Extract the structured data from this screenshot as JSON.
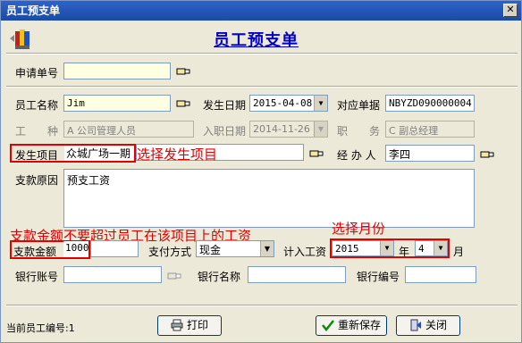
{
  "window": {
    "title": "员工预支单",
    "close_glyph": "✕"
  },
  "form_title": "员工预支单",
  "fields": {
    "request_no": {
      "label": "申请单号",
      "value": ""
    },
    "employee_name": {
      "label": "员工名称",
      "value": "Jim"
    },
    "occur_date": {
      "label": "发生日期",
      "value": "2015-04-08"
    },
    "ref_no": {
      "label": "对应单据",
      "value": "NBYZD090000004"
    },
    "job_type": {
      "label": "工　　种",
      "value": "A 公司管理人员"
    },
    "hire_date": {
      "label": "入职日期",
      "value": "2014-11-26"
    },
    "position": {
      "label": "职　　务",
      "value": "C 副总经理"
    },
    "project": {
      "label": "发生项目",
      "value": "众城广场一期"
    },
    "handler": {
      "label": "经 办 人",
      "value": "李四"
    },
    "reason": {
      "label": "支款原因",
      "value": "预支工资"
    },
    "amount": {
      "label": "支款金额",
      "value": "1000"
    },
    "pay_method": {
      "label": "支付方式",
      "value": "现金"
    },
    "salary_period": {
      "label": "计入工资",
      "year": "2015",
      "year_unit": "年",
      "month": "4",
      "month_unit": "月"
    },
    "bank_account": {
      "label": "银行账号",
      "value": ""
    },
    "bank_name": {
      "label": "银行名称",
      "value": ""
    },
    "bank_code": {
      "label": "银行编号",
      "value": ""
    }
  },
  "annotations": {
    "project": "选择发生项目",
    "amount": "支款金额不要超过员工在该项目上的工资",
    "month": "选择月份"
  },
  "buttons": {
    "print": "打印",
    "save": "重新保存",
    "close": "关闭"
  },
  "status": {
    "label": "当前员工编号:",
    "value": "1"
  },
  "colors": {
    "annotation": "#e00000",
    "title": "#0000c8",
    "titlebar": "#1b4aa6"
  },
  "icons": [
    "logo-icon",
    "pick-hand-icon",
    "printer-icon",
    "save-check-icon",
    "exit-door-icon",
    "dropdown-arrow-icon"
  ]
}
